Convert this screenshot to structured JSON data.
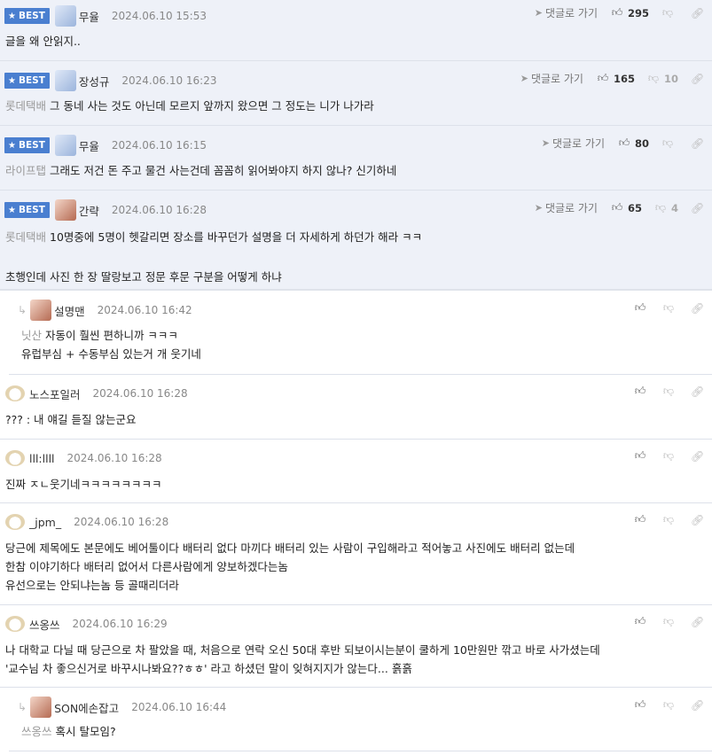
{
  "reply_link_label": "댓글로 가기",
  "comments": [
    {
      "badge": "BEST",
      "nick": "무율",
      "date": "2024.06.10 15:53",
      "tag": "",
      "lines": [
        "글을 왜 안읽지.."
      ],
      "up": "295",
      "down": ""
    },
    {
      "badge": "BEST",
      "nick": "장성규",
      "date": "2024.06.10 16:23",
      "tag": "롯데택배",
      "lines": [
        "그 동네 사는 것도 아닌데 모르지 앞까지 왔으면 그 정도는 니가 나가라"
      ],
      "up": "165",
      "down": "10"
    },
    {
      "badge": "BEST",
      "nick": "무율",
      "date": "2024.06.10 16:15",
      "tag": "라이프탭",
      "lines": [
        "그래도 저건 돈 주고 물건 사는건데 꼼꼼히 읽어봐야지 하지 않나? 신기하네"
      ],
      "up": "80",
      "down": ""
    },
    {
      "badge": "BEST",
      "nick": "간략",
      "date": "2024.06.10 16:28",
      "tag": "롯데택배",
      "lines": [
        "10명중에 5명이 헷갈리면 장소를 바꾸던가 설명을 더 자세하게 하던가 해라 ㅋㅋ",
        "",
        "초행인데 사진 한 장 딸랑보고 정문 후문 구분을 어떻게 하냐"
      ],
      "up": "65",
      "down": "4"
    },
    {
      "nick": "설명맨",
      "date": "2024.06.10 16:42",
      "tag": "닛산",
      "lines": [
        "자동이 훨씬 편하니까 ㅋㅋㅋ",
        "유럽부심 + 수동부심 있는거 개 웃기네"
      ]
    },
    {
      "nick": "노스포일러",
      "date": "2024.06.10 16:28",
      "tag": "",
      "lines": [
        "??? : 내 얘길 듣질 않는군요"
      ]
    },
    {
      "nick": "lll:llll",
      "date": "2024.06.10 16:28",
      "tag": "",
      "lines": [
        "진짜 ㅈㄴ웃기네ㅋㅋㅋㅋㅋㅋㅋㅋ"
      ]
    },
    {
      "nick": "_jpm_",
      "date": "2024.06.10 16:28",
      "tag": "",
      "lines": [
        "당근에 제목에도 본문에도 베어툴이다 배터리 없다 마끼다 배터리 있는 사람이 구입해라고 적어놓고 사진에도 배터리 없는데",
        "한참 이야기하다 배터리 없어서 다른사람에게 양보하겠다는놈",
        "유선으로는 안되냐는놈 등 골때리더라"
      ]
    },
    {
      "nick": "쓰옹쓰",
      "date": "2024.06.10 16:29",
      "tag": "",
      "lines": [
        "나 대학교 다닐 때 당근으로 차 팔았을 때, 처음으로 연락 오신 50대 후반 되보이시는분이 쿨하게 10만원만 깎고 바로 사가셨는데",
        "'교수님 차 좋으신거로 바꾸시나봐요??ㅎㅎ' 라고 하셨던 말이 잊혀지지가 않는다... 흙흙"
      ]
    },
    {
      "nick": "SON에손잡고",
      "date": "2024.06.10 16:44",
      "tag": "쓰옹쓰",
      "lines": [
        "혹시 탈모임?"
      ]
    }
  ]
}
